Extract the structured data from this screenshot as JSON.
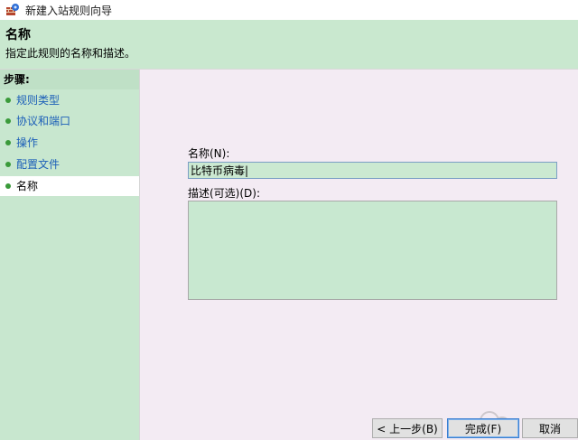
{
  "window": {
    "title": "新建入站规则向导"
  },
  "header": {
    "title": "名称",
    "subtitle": "指定此规则的名称和描述。"
  },
  "steps": {
    "label": "步骤:",
    "items": [
      {
        "label": "规则类型",
        "current": false
      },
      {
        "label": "协议和端口",
        "current": false
      },
      {
        "label": "操作",
        "current": false
      },
      {
        "label": "配置文件",
        "current": false
      },
      {
        "label": "名称",
        "current": true
      }
    ]
  },
  "form": {
    "name_label": "名称(N):",
    "name_value": "比特币病毒|",
    "description_label": "描述(可选)(D):",
    "description_value": ""
  },
  "buttons": {
    "back": "< 上一步(B)",
    "finish": "完成(F)",
    "cancel": "取消"
  },
  "colors": {
    "header_bg": "#c9e8cf",
    "steps_bg": "#c8e7cf",
    "content_bg": "#f3ebf3",
    "step_link": "#1c5fb8"
  }
}
